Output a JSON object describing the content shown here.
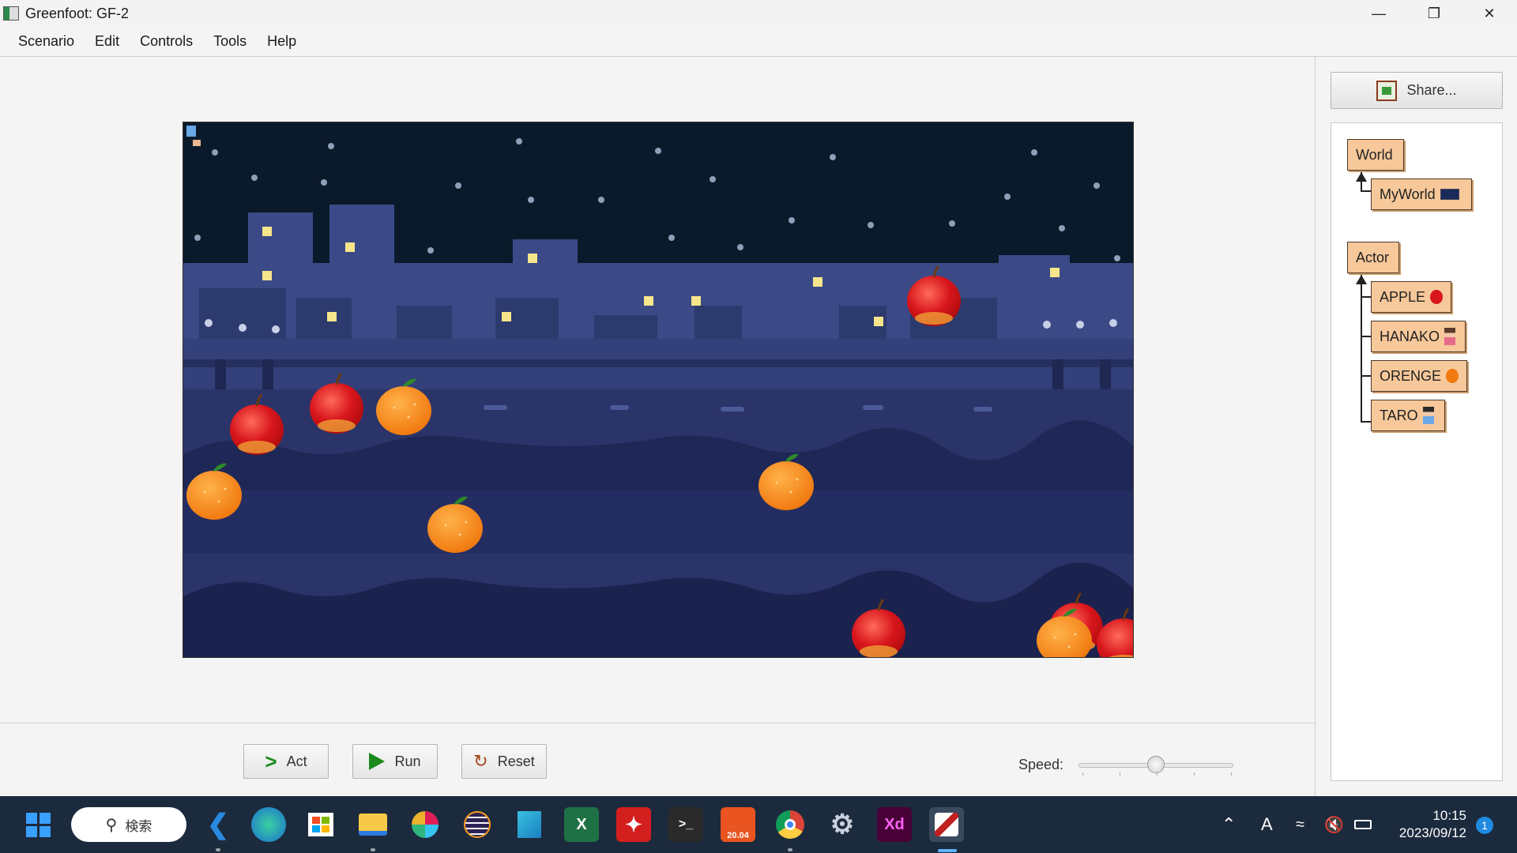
{
  "window": {
    "title": "Greenfoot: GF-2"
  },
  "menu": {
    "items": [
      "Scenario",
      "Edit",
      "Controls",
      "Tools",
      "Help"
    ]
  },
  "controls": {
    "act": "Act",
    "run": "Run",
    "reset": "Reset",
    "speed_label": "Speed:",
    "speed_value": 0.5
  },
  "share": {
    "label": "Share..."
  },
  "classes": {
    "world": "World",
    "myworld": "MyWorld",
    "actor": "Actor",
    "subclasses": [
      "APPLE",
      "HANAKO",
      "ORENGE",
      "TARO"
    ]
  },
  "taskbar": {
    "search": "検索",
    "clock_time": "10:15",
    "clock_date": "2023/09/12",
    "notification_count": "1",
    "icons": [
      "windows-start-icon",
      "vscode-icon",
      "edge-icon",
      "store-icon",
      "file-explorer-icon",
      "slack-icon",
      "eclipse-icon",
      "app-icon",
      "excel-icon",
      "acrobat-icon",
      "terminal-icon",
      "ubuntu-icon",
      "chrome-icon",
      "settings-icon",
      "xd-icon",
      "greenfoot-icon"
    ],
    "ubuntu_label": "20.04",
    "excel_label": "X",
    "xd_label": "Xd"
  },
  "colors": {
    "class_box": "#f7c89a",
    "taskbar": "#1c2a3d",
    "sky": "#0b1a2b"
  }
}
